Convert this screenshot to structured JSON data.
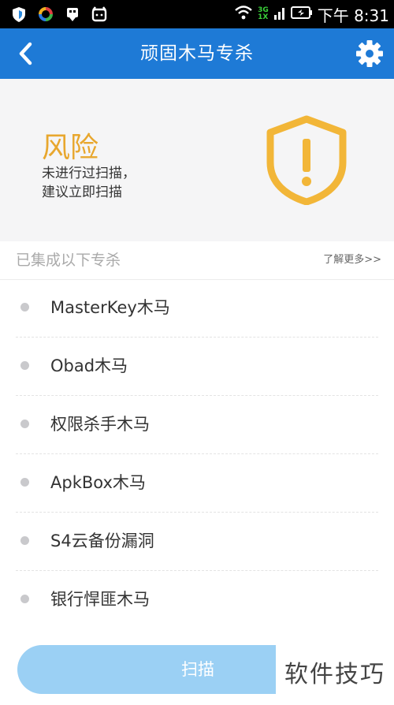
{
  "status_bar": {
    "time": "下午 8:31",
    "network": [
      "3G",
      "1X"
    ]
  },
  "header": {
    "title": "顽固木马专杀"
  },
  "risk": {
    "title": "风险",
    "description_lines": [
      "未进行过扫描，",
      "建议立即扫描"
    ],
    "shield_color": "#f2b638"
  },
  "section": {
    "title": "已集成以下专杀",
    "learn_more": "了解更多>>"
  },
  "items": [
    {
      "label": "MasterKey木马"
    },
    {
      "label": "Obad木马"
    },
    {
      "label": "权限杀手木马"
    },
    {
      "label": "ApkBox木马"
    },
    {
      "label": "S4云备份漏洞"
    },
    {
      "label": "银行悍匪木马"
    }
  ],
  "scan_button": {
    "label": "扫描"
  },
  "watermark": "软件技巧",
  "colors": {
    "header_bg": "#1e7ad6",
    "risk_text": "#e8a72e",
    "button_bg": "#9bd0f4"
  }
}
